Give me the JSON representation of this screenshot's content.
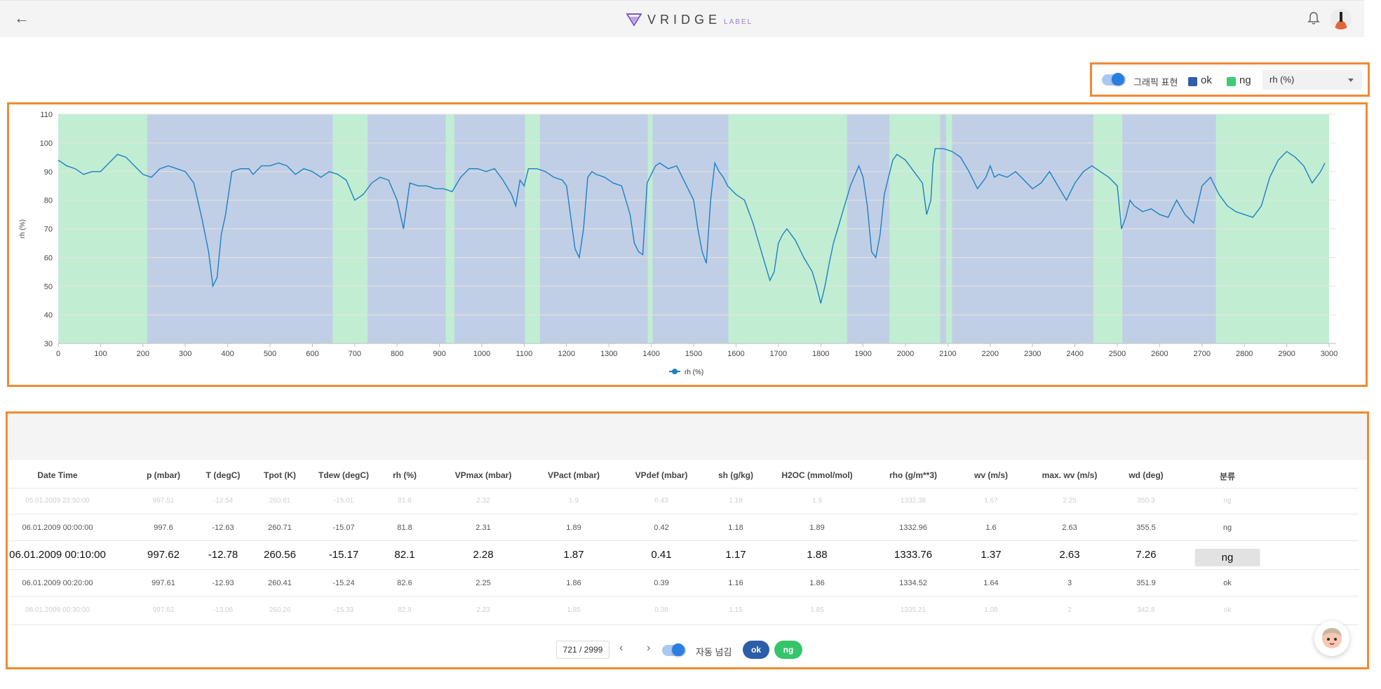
{
  "header": {
    "back_icon": "arrow-left-icon",
    "logo_text": "VRIDGE",
    "logo_sub": "LABEL",
    "notifications_icon": "bell-icon",
    "avatar_icon": "avatar"
  },
  "controls": {
    "graphic_toggle_label": "그래픽 표현",
    "graphic_toggle_on": true,
    "legend_ok": "ok",
    "legend_ng": "ng",
    "ok_color": "#2f5fa8",
    "ng_color": "#3ecb73",
    "selected_metric": "rh (%)"
  },
  "chart_data": {
    "type": "line",
    "ylabel": "rh (%)",
    "legend": "rh (%)",
    "legend_position": "bottom-center",
    "xlim": [
      0,
      3000
    ],
    "ylim": [
      30,
      110
    ],
    "x_ticks": [
      0,
      100,
      200,
      300,
      400,
      500,
      600,
      700,
      800,
      900,
      1000,
      1100,
      1200,
      1300,
      1400,
      1500,
      1600,
      1700,
      1800,
      1900,
      2000,
      2100,
      2200,
      2300,
      2400,
      2500,
      2600,
      2700,
      2800,
      2900,
      3000
    ],
    "y_ticks": [
      30,
      40,
      50,
      60,
      70,
      80,
      90,
      100,
      110
    ],
    "grid": true,
    "line_color": "#1f7fc4",
    "background_regions": [
      {
        "label": "ng",
        "from": 0,
        "to": 210
      },
      {
        "label": "ok",
        "from": 210,
        "to": 648
      },
      {
        "label": "ng",
        "from": 648,
        "to": 730
      },
      {
        "label": "ok",
        "from": 730,
        "to": 915
      },
      {
        "label": "ng",
        "from": 915,
        "to": 935
      },
      {
        "label": "ok",
        "from": 935,
        "to": 1102
      },
      {
        "label": "ng",
        "from": 1102,
        "to": 1137
      },
      {
        "label": "ok",
        "from": 1137,
        "to": 1392
      },
      {
        "label": "ng",
        "from": 1392,
        "to": 1403
      },
      {
        "label": "ok",
        "from": 1403,
        "to": 1582
      },
      {
        "label": "ng",
        "from": 1582,
        "to": 1862
      },
      {
        "label": "ok",
        "from": 1862,
        "to": 1962
      },
      {
        "label": "ng",
        "from": 1962,
        "to": 2082
      },
      {
        "label": "ok",
        "from": 2082,
        "to": 2096
      },
      {
        "label": "ng",
        "from": 2096,
        "to": 2110
      },
      {
        "label": "ok",
        "from": 2110,
        "to": 2444
      },
      {
        "label": "ng",
        "from": 2444,
        "to": 2512
      },
      {
        "label": "ok",
        "from": 2512,
        "to": 2733
      },
      {
        "label": "ng",
        "from": 2733,
        "to": 3000
      }
    ],
    "series": [
      {
        "name": "rh (%)",
        "x": [
          0,
          20,
          40,
          60,
          80,
          100,
          120,
          140,
          160,
          180,
          200,
          220,
          240,
          260,
          280,
          300,
          320,
          340,
          355,
          365,
          375,
          385,
          395,
          410,
          430,
          450,
          460,
          480,
          500,
          520,
          540,
          560,
          580,
          600,
          620,
          640,
          660,
          680,
          700,
          720,
          740,
          760,
          780,
          800,
          815,
          830,
          850,
          870,
          890,
          910,
          930,
          950,
          970,
          990,
          1010,
          1030,
          1050,
          1070,
          1080,
          1090,
          1100,
          1110,
          1130,
          1150,
          1170,
          1190,
          1200,
          1210,
          1220,
          1230,
          1240,
          1250,
          1260,
          1270,
          1290,
          1310,
          1330,
          1350,
          1360,
          1370,
          1380,
          1390,
          1400,
          1410,
          1420,
          1440,
          1460,
          1480,
          1500,
          1510,
          1520,
          1530,
          1540,
          1550,
          1560,
          1570,
          1580,
          1600,
          1620,
          1640,
          1660,
          1680,
          1690,
          1700,
          1710,
          1720,
          1740,
          1760,
          1780,
          1790,
          1800,
          1810,
          1820,
          1830,
          1840,
          1850,
          1870,
          1890,
          1900,
          1910,
          1920,
          1930,
          1940,
          1950,
          1960,
          1970,
          1980,
          2000,
          2020,
          2040,
          2050,
          2060,
          2065,
          2070,
          2090,
          2110,
          2130,
          2150,
          2170,
          2190,
          2200,
          2210,
          2220,
          2240,
          2260,
          2280,
          2300,
          2320,
          2340,
          2360,
          2380,
          2400,
          2420,
          2440,
          2460,
          2480,
          2500,
          2510,
          2520,
          2530,
          2540,
          2560,
          2580,
          2600,
          2620,
          2640,
          2660,
          2680,
          2700,
          2720,
          2740,
          2760,
          2780,
          2800,
          2820,
          2840,
          2860,
          2880,
          2900,
          2920,
          2940,
          2960,
          2980,
          2990
        ],
        "values": [
          94,
          92,
          91,
          89,
          90,
          90,
          93,
          96,
          95,
          92,
          89,
          88,
          91,
          92,
          91,
          90,
          86,
          73,
          62,
          50,
          53,
          68,
          75,
          90,
          91,
          91,
          89,
          92,
          92,
          93,
          92,
          89,
          91,
          90,
          88,
          90,
          89,
          87,
          80,
          82,
          86,
          88,
          87,
          80,
          70,
          86,
          85,
          85,
          84,
          84,
          83,
          88,
          91,
          91,
          90,
          91,
          87,
          82,
          78,
          87,
          85,
          91,
          91,
          90,
          88,
          87,
          85,
          74,
          63,
          60,
          70,
          88,
          90,
          89,
          88,
          86,
          85,
          75,
          65,
          62,
          61,
          86,
          89,
          92,
          93,
          91,
          92,
          86,
          80,
          70,
          62,
          58,
          80,
          93,
          90,
          88,
          85,
          82,
          80,
          72,
          62,
          52,
          55,
          65,
          68,
          70,
          66,
          60,
          55,
          50,
          44,
          50,
          58,
          65,
          70,
          75,
          85,
          92,
          88,
          78,
          62,
          60,
          68,
          82,
          88,
          94,
          96,
          94,
          90,
          86,
          75,
          80,
          93,
          98,
          98,
          97,
          95,
          90,
          84,
          88,
          92,
          88,
          89,
          88,
          90,
          87,
          84,
          86,
          90,
          85,
          80,
          86,
          90,
          92,
          90,
          88,
          85,
          70,
          74,
          80,
          78,
          76,
          77,
          75,
          74,
          80,
          75,
          72,
          85,
          88,
          82,
          78,
          76,
          75,
          74,
          78,
          88,
          94,
          97,
          95,
          92,
          86,
          90,
          93
        ]
      }
    ]
  },
  "table": {
    "headers": [
      "Date Time",
      "p (mbar)",
      "T (degC)",
      "Tpot (K)",
      "Tdew (degC)",
      "rh (%)",
      "VPmax (mbar)",
      "VPact (mbar)",
      "VPdef (mbar)",
      "sh (g/kg)",
      "H2OC (mmol/mol)",
      "rho (g/m**3)",
      "wv (m/s)",
      "max. wv (m/s)",
      "wd (deg)",
      "분류"
    ],
    "rows": [
      [
        "05.01.2009 23:50:00",
        "997.51",
        "-12.54",
        "260.81",
        "-15.01",
        "81.6",
        "2.32",
        "1.9",
        "0.43",
        "1.18",
        "1.9",
        "1332.38",
        "1.67",
        "2.25",
        "350.3",
        "ng"
      ],
      [
        "06.01.2009 00:00:00",
        "997.6",
        "-12.63",
        "260.71",
        "-15.07",
        "81.8",
        "2.31",
        "1.89",
        "0.42",
        "1.18",
        "1.89",
        "1332.96",
        "1.6",
        "2.63",
        "355.5",
        "ng"
      ],
      [
        "06.01.2009 00:10:00",
        "997.62",
        "-12.78",
        "260.56",
        "-15.17",
        "82.1",
        "2.28",
        "1.87",
        "0.41",
        "1.17",
        "1.88",
        "1333.76",
        "1.37",
        "2.63",
        "7.26",
        "ng"
      ],
      [
        "06.01.2009 00:20:00",
        "997.61",
        "-12.93",
        "260.41",
        "-15.24",
        "82.6",
        "2.25",
        "1.86",
        "0.39",
        "1.16",
        "1.86",
        "1334.52",
        "1.64",
        "3",
        "351.9",
        "ok"
      ],
      [
        "06.01.2009 00:30:00",
        "997.62",
        "-13.06",
        "260.26",
        "-15.33",
        "82.9",
        "2.23",
        "1.85",
        "0.38",
        "1.15",
        "1.85",
        "1335.21",
        "1.08",
        "2",
        "342.8",
        "ok"
      ]
    ]
  },
  "footer": {
    "page_indicator": "721 / 2999",
    "prev_icon": "chevron-left-icon",
    "next_icon": "chevron-right-icon",
    "auto_next_label": "자동 넘김",
    "auto_next_on": true,
    "ok_button": "ok",
    "ng_button": "ng"
  }
}
